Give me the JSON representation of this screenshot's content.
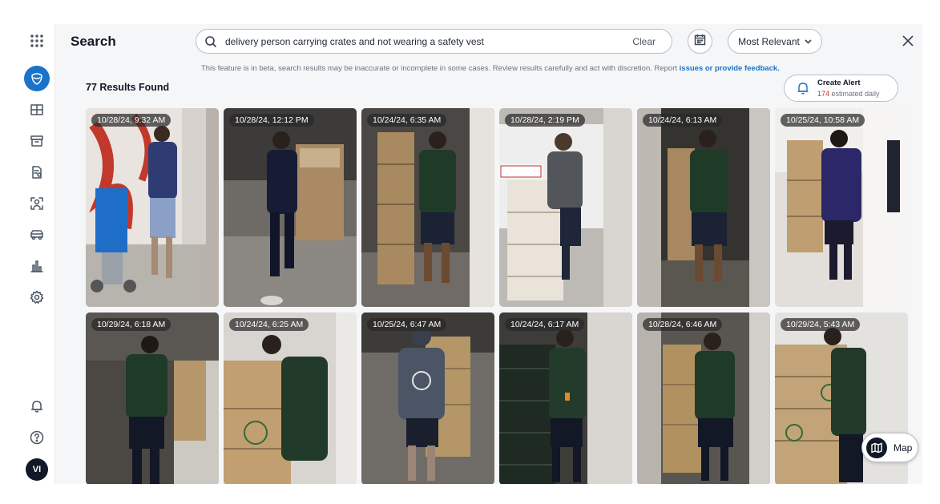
{
  "sidebar": {
    "items": [
      {
        "icon": "app-grid-icon"
      },
      {
        "icon": "shield-icon",
        "active": true
      },
      {
        "icon": "layout-grid-icon"
      },
      {
        "icon": "archive-icon"
      },
      {
        "icon": "document-search-icon"
      },
      {
        "icon": "face-scan-icon"
      },
      {
        "icon": "vehicle-icon"
      },
      {
        "icon": "bar-chart-icon"
      },
      {
        "icon": "gear-icon"
      },
      {
        "icon": "bell-icon"
      },
      {
        "icon": "help-icon"
      }
    ],
    "avatar_initials": "VI"
  },
  "header": {
    "title": "Search",
    "search_value": "delivery person carrying crates and not wearing a safety vest",
    "clear_label": "Clear",
    "sort_label": "Most Relevant"
  },
  "beta_note": {
    "text": "This feature is in beta, search results may be inaccurate or incomplete in some cases. Review results carefully and act with discretion. Report ",
    "link": "issues or provide feedback."
  },
  "results": {
    "count_label": "77 Results Found",
    "alert_label": "Create Alert",
    "alert_count": "174",
    "alert_suffix": " estimated daily",
    "items": [
      {
        "timestamp": "10/28/24, 9:32 AM"
      },
      {
        "timestamp": "10/28/24, 12:12 PM"
      },
      {
        "timestamp": "10/24/24, 6:35 AM"
      },
      {
        "timestamp": "10/28/24, 2:19 PM"
      },
      {
        "timestamp": "10/24/24, 6:13 AM"
      },
      {
        "timestamp": "10/25/24, 10:58 AM"
      },
      {
        "timestamp": "10/29/24, 6:18 AM"
      },
      {
        "timestamp": "10/24/24, 6:25 AM"
      },
      {
        "timestamp": "10/25/24, 6:47 AM"
      },
      {
        "timestamp": "10/24/24, 6:17 AM"
      },
      {
        "timestamp": "10/28/24, 6:46 AM"
      },
      {
        "timestamp": "10/29/24, 5:43 AM"
      }
    ]
  },
  "map_button": {
    "label": "Map"
  },
  "colors": {
    "accent": "#1a73c9",
    "alert_count": "#dc2626"
  }
}
